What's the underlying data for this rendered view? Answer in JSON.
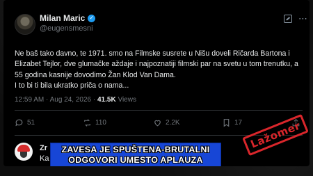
{
  "post": {
    "display_name": "Milan Maric",
    "verified_mark": "✓",
    "handle": "@eugensmesni",
    "more_icon": "⋯",
    "body": "Ne baš tako davno, te 1971. smo na Filmske susrete u Nišu doveli Ričarda Bartona i Elizabet Tejlor, dve glumačke aždaje i najpoznatiji filmski par na svetu u tom trenutku, a 55 godina kasnije dovodimo Žan Klod Van Dama.\nI to bi ti bila ukratko priča o nama...",
    "time": "12:59 AM · Aug 24, 2026 · ",
    "views_count": "41.5K",
    "views_label": " Views"
  },
  "actions": {
    "replies": "51",
    "reposts": "110",
    "likes": "2.2K",
    "bookmarks": "17"
  },
  "reply": {
    "name_partial": "Zr",
    "text_partial": "Ka"
  },
  "overlay": {
    "banner_line1": "ZAVESA JE SPUŠTENA-BRUTALNI",
    "banner_line2": "ODGOVORI UMESTO APLAUZA",
    "stamp": "Lažomer"
  },
  "colors": {
    "accent": "#1d9bf0",
    "banner": "#1746d6",
    "stamp": "#d9262b"
  }
}
